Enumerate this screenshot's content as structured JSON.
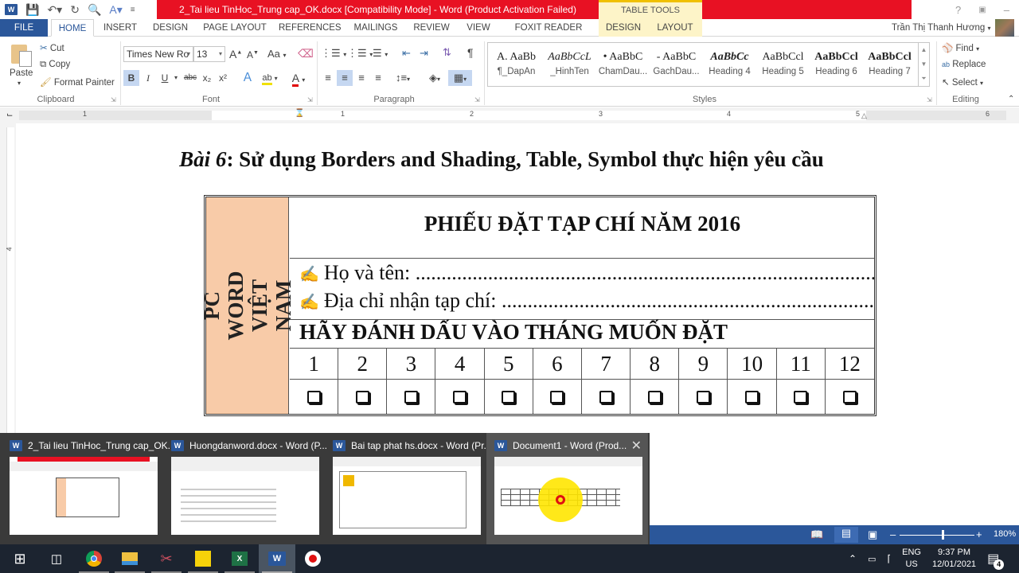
{
  "title_bar": {
    "document_title": "2_Tai lieu TinHoc_Trung cap_OK.docx [Compatibility Mode] - Word (Product Activation Failed)",
    "context_tab_group": "TABLE TOOLS",
    "window_controls": [
      "?",
      "ribbon-display-options",
      "minimize",
      "restore",
      "close"
    ]
  },
  "quick_access": [
    "word-icon",
    "save-icon",
    "undo-icon",
    "redo-icon",
    "print-preview-icon",
    "spelling-icon",
    "customize-icon"
  ],
  "tabs": [
    {
      "label": "FILE"
    },
    {
      "label": "HOME",
      "active": true
    },
    {
      "label": "INSERT"
    },
    {
      "label": "DESIGN"
    },
    {
      "label": "PAGE LAYOUT"
    },
    {
      "label": "REFERENCES"
    },
    {
      "label": "MAILINGS"
    },
    {
      "label": "REVIEW"
    },
    {
      "label": "VIEW"
    },
    {
      "label": "FOXIT READER PDF"
    },
    {
      "label": "DESIGN",
      "context": true
    },
    {
      "label": "LAYOUT",
      "context": true
    }
  ],
  "user": {
    "name": "Trần Thị Thanh Hương"
  },
  "ribbon": {
    "clipboard": {
      "label": "Clipboard",
      "paste": "Paste",
      "cut": "Cut",
      "copy": "Copy",
      "format_painter": "Format Painter"
    },
    "font": {
      "label": "Font",
      "font_name": "Times New Ro",
      "font_size": "13",
      "bold": "B",
      "italic": "I",
      "underline": "U",
      "strikethrough": "abc",
      "subscript": "x₂",
      "superscript": "x²",
      "change_case": "Aa"
    },
    "paragraph": {
      "label": "Paragraph"
    },
    "styles": {
      "label": "Styles",
      "items": [
        {
          "preview": "A. AaBb",
          "name": "¶_DapAn"
        },
        {
          "preview": "AaBbCcL",
          "name": "_HinhTen"
        },
        {
          "preview": "• AaBbC",
          "name": "ChamDau..."
        },
        {
          "preview": "- AaBbC",
          "name": "GachDau..."
        },
        {
          "preview": "AaBbCc",
          "name": "Heading 4"
        },
        {
          "preview": "AaBbCcl",
          "name": "Heading 5"
        },
        {
          "preview": "AaBbCcl",
          "name": "Heading 6"
        },
        {
          "preview": "AaBbCcl",
          "name": "Heading 7"
        }
      ]
    },
    "editing": {
      "label": "Editing",
      "find": "Find",
      "replace": "Replace",
      "select": "Select"
    }
  },
  "ruler": {
    "numbers": [
      "1",
      "1",
      "2",
      "3",
      "4",
      "5",
      "6"
    ]
  },
  "document": {
    "heading_prefix": "Bài 6",
    "heading_rest": ": Sử dụng Borders and Shading, Table, Symbol thực hiện yêu cầu",
    "form": {
      "side_text": "PC WORD VIỆT NAM",
      "title": "PHIẾU ĐẶT TẠP CHÍ NĂM 2016",
      "fields": [
        {
          "label": "Họ và tên:",
          "fill": "........................................................................................................"
        },
        {
          "label": "Địa chỉ nhận tạp chí:",
          "fill": "......................................................................................"
        }
      ],
      "pen_symbol": "✍",
      "mark_title": "HÃY ĐÁNH DẤU VÀO THÁNG MUỐN ĐẶT",
      "months": [
        "1",
        "2",
        "3",
        "4",
        "5",
        "6",
        "7",
        "8",
        "9",
        "10",
        "11",
        "12"
      ]
    }
  },
  "taskbar_previews": [
    {
      "title": "2_Tai lieu TinHoc_Trung cap_OK..."
    },
    {
      "title": "Huongdanword.docx - Word (P..."
    },
    {
      "title": "Bai tap phat hs.docx - Word (Pr..."
    },
    {
      "title": "Document1 - Word (Prod...",
      "active": true
    }
  ],
  "status_bar": {
    "zoom": "180%",
    "zoom_fraction": 0.6
  },
  "taskbar": {
    "apps": [
      "start",
      "task-view",
      "chrome",
      "file-explorer",
      "snipping-tool",
      "sticky-notes",
      "excel",
      "word",
      "recorder"
    ],
    "lang_top": "ENG",
    "lang_bottom": "US",
    "time": "9:37 PM",
    "date": "12/01/2021",
    "notifications": "4"
  }
}
